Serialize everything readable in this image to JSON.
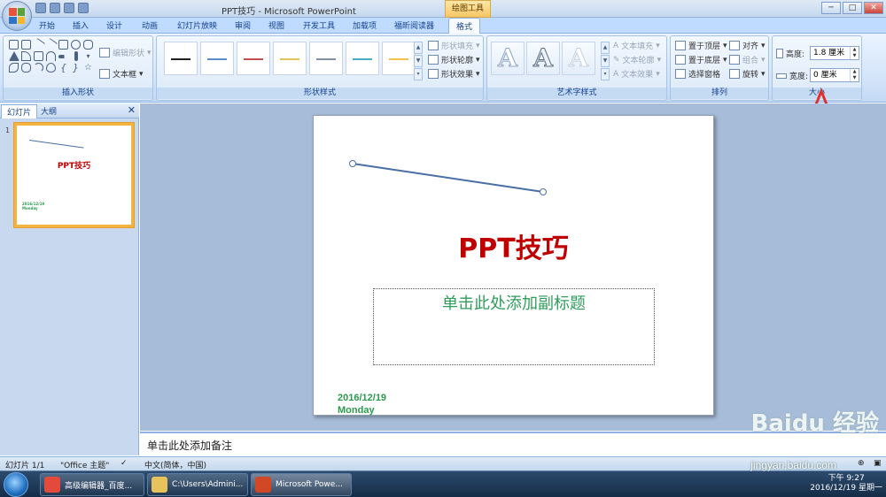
{
  "window": {
    "title": "PPT技巧 - Microsoft PowerPoint",
    "context_group": "绘图工具",
    "min": "─",
    "max": "□",
    "close": "✕"
  },
  "ribbon_tabs": [
    {
      "label": "开始"
    },
    {
      "label": "插入"
    },
    {
      "label": "设计"
    },
    {
      "label": "动画"
    },
    {
      "label": "幻灯片放映"
    },
    {
      "label": "审阅"
    },
    {
      "label": "视图"
    },
    {
      "label": "开发工具"
    },
    {
      "label": "加载项"
    },
    {
      "label": "福昕阅读器"
    },
    {
      "label": "格式"
    }
  ],
  "active_tab": "格式",
  "groups": {
    "insert_shapes": {
      "label": "插入形状",
      "edit_shape": "编辑形状",
      "text_box": "文本框"
    },
    "shape_styles": {
      "label": "形状样式",
      "fill": "形状填充",
      "outline": "形状轮廓",
      "effects": "形状效果",
      "swatches": [
        "#1f1f1f",
        "#5b8fc8",
        "#c0504d",
        "#e3c45a",
        "#7f8fa9",
        "#4bacc6",
        "#f2c14e"
      ]
    },
    "wordart": {
      "label": "艺术字样式",
      "glyph": "A",
      "text_fill": "文本填充",
      "text_outline": "文本轮廓",
      "text_effects": "文本效果"
    },
    "arrange": {
      "label": "排列",
      "bring_front": "置于顶层",
      "send_back": "置于底层",
      "selection_pane": "选择窗格",
      "align": "对齐",
      "group": "组合",
      "rotate": "旋转"
    },
    "size": {
      "label": "大小",
      "height_label": "高度:",
      "height_value": "1.8 厘米",
      "width_label": "宽度:",
      "width_value": "0 厘米"
    }
  },
  "left_pane": {
    "tab_slides": "幻灯片",
    "tab_outline": "大纲",
    "close": "✕",
    "thumb_number": "1",
    "thumb_title": "PPT技巧",
    "thumb_date": "2016/12/19",
    "thumb_day": "Monday"
  },
  "slide": {
    "title": "PPT技巧",
    "subtitle_placeholder": "单击此处添加副标题",
    "date": "2016/12/19",
    "day": "Monday"
  },
  "notes_placeholder": "单击此处添加备注",
  "status_bar": {
    "slide_count": "幻灯片 1/1",
    "theme": "\"Office 主题\"",
    "language": "中文(简体，中国)"
  },
  "taskbar": {
    "items": [
      {
        "label": "高级编辑器_百度...",
        "color": "#e24a3b"
      },
      {
        "label": "C:\\Users\\Admini...",
        "color": "#e8c25a"
      },
      {
        "label": "Microsoft Powe...",
        "color": "#d24726"
      }
    ],
    "time": "下午 9:27",
    "date": "2016/12/19 星期一"
  },
  "watermark": {
    "logo": "Baidu 经验",
    "url": "jingyan.baidu.com"
  },
  "annotation_color": "#e03030",
  "accent_colors": {
    "title_red": "#c00000",
    "green_text": "#2a9a4e",
    "line_blue": "#4a6fa5"
  }
}
